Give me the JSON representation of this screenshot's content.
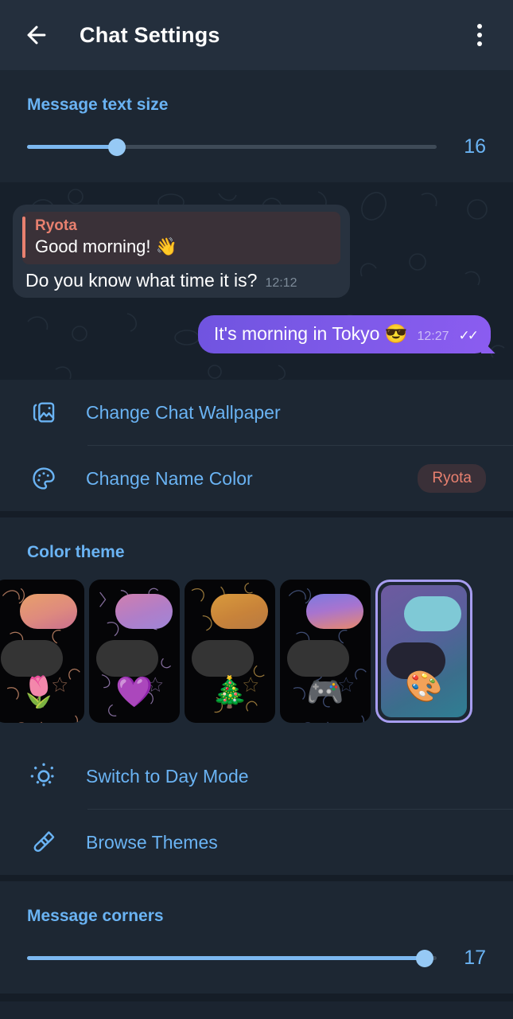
{
  "appbar": {
    "back_icon": "arrow-left-icon",
    "title": "Chat Settings",
    "menu_icon": "overflow-menu-icon"
  },
  "text_size": {
    "header": "Message text size",
    "value": "16",
    "percent": 22,
    "min": 12,
    "max": 30
  },
  "chat_preview": {
    "incoming": {
      "reply_name": "Ryota",
      "reply_text": "Good morning! 👋",
      "text": "Do you know what time it is?",
      "time": "12:12"
    },
    "outgoing": {
      "text": "It's morning in Tokyo 😎",
      "time": "12:27",
      "ticks": "✓✓"
    },
    "bubble_out_color": "#7f5ae9",
    "bubble_in_color": "#28323f",
    "accent_color": "#e8806f"
  },
  "actions": {
    "wallpaper": {
      "icon": "image-stack-icon",
      "label": "Change Chat Wallpaper"
    },
    "name_color": {
      "icon": "palette-icon",
      "label": "Change Name Color",
      "badge": "Ryota"
    }
  },
  "color_theme": {
    "header": "Color theme",
    "items": [
      {
        "name": "tulip-theme",
        "emoji": "🌷",
        "out_gradient": "linear-gradient(160deg,#e8a06a 0%,#de8a7e 55%,#c9708f 100%)",
        "doodle_color": "#c98a6a",
        "selected": false
      },
      {
        "name": "purple-heart-theme",
        "emoji": "💜",
        "out_gradient": "linear-gradient(160deg,#d07fae 0%,#b07ec8 55%,#9f86d8 100%)",
        "doodle_color": "#9a7fb5",
        "selected": false
      },
      {
        "name": "christmas-tree-theme",
        "emoji": "🎄",
        "out_gradient": "linear-gradient(160deg,#d99a3c 0%,#c8833a 55%,#b87a42 100%)",
        "doodle_color": "#b08a42",
        "selected": false
      },
      {
        "name": "gaming-theme",
        "emoji": "🎮",
        "out_gradient": "linear-gradient(170deg,#7b7ae0 0%,#a874cf 45%,#e8896d 100%)",
        "doodle_color": "#4a5a86",
        "selected": false
      },
      {
        "name": "palette-theme",
        "emoji": "🎨",
        "out_gradient": "#7fc9d6",
        "doodle_color": "#5a5f9c",
        "selected": true
      }
    ]
  },
  "day_mode": {
    "icon": "sun-icon",
    "label": "Switch to Day Mode"
  },
  "browse_themes": {
    "icon": "paintbrush-icon",
    "label": "Browse Themes"
  },
  "message_corners": {
    "header": "Message corners",
    "value": "17",
    "percent": 97,
    "min": 0,
    "max": 17
  }
}
